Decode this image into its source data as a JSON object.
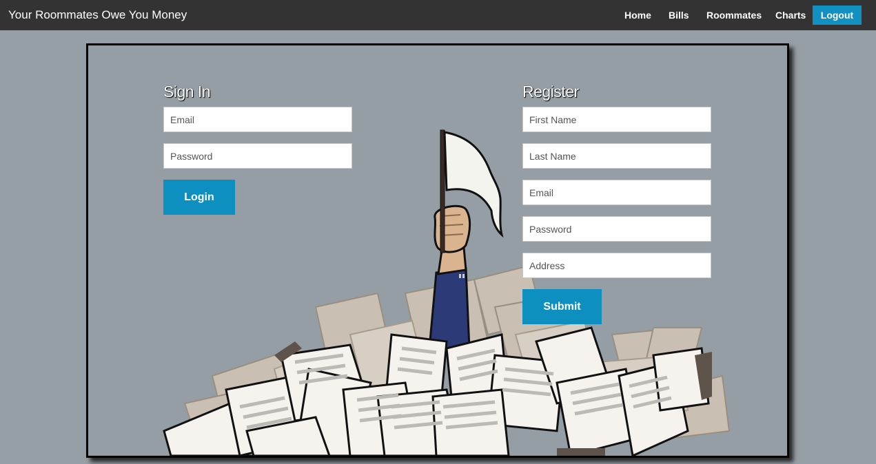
{
  "navbar": {
    "brand": "Your Roommates Owe You Money",
    "items": [
      {
        "label": "Home"
      },
      {
        "label": "Bills"
      },
      {
        "label": "Roommates"
      },
      {
        "label": "Charts"
      }
    ],
    "logout_label": "Logout"
  },
  "signin": {
    "title": "Sign In",
    "email_placeholder": "Email",
    "password_placeholder": "Password",
    "login_label": "Login"
  },
  "register": {
    "title": "Register",
    "first_name_placeholder": "First Name",
    "last_name_placeholder": "Last Name",
    "email_placeholder": "Email",
    "password_placeholder": "Password",
    "address_placeholder": "Address",
    "submit_label": "Submit"
  },
  "colors": {
    "navbar_bg": "#333333",
    "accent": "#0d8fc0",
    "page_bg": "#969fa5"
  }
}
